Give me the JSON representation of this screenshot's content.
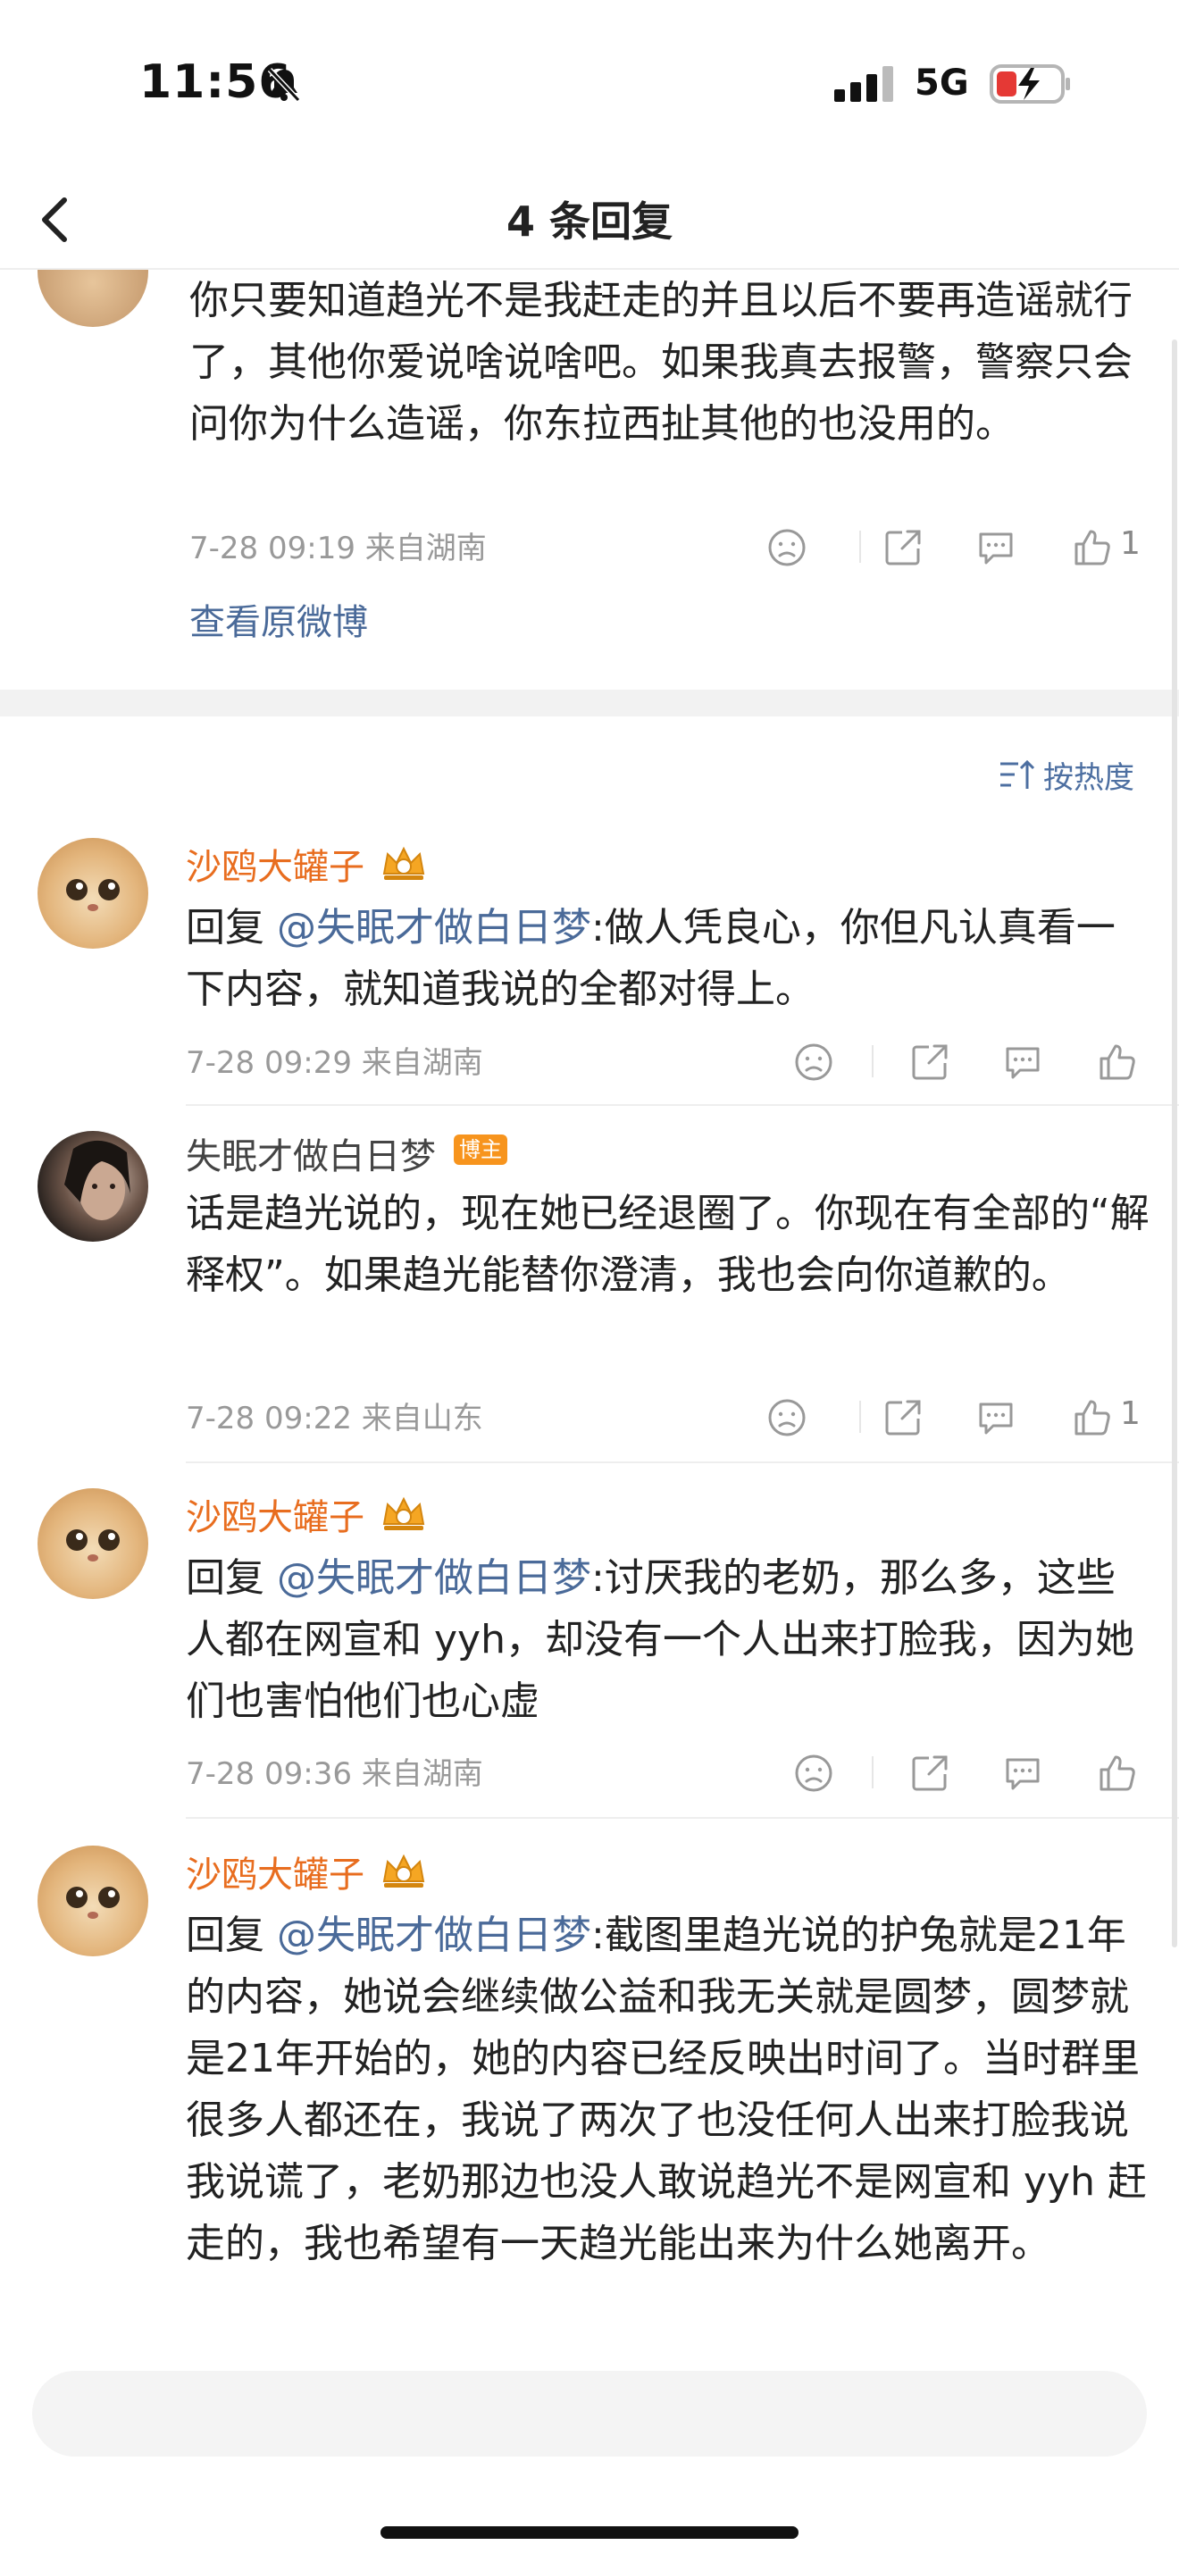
{
  "status_bar": {
    "time": "11:56",
    "network": "5G"
  },
  "nav": {
    "title": "4 条回复"
  },
  "original_post": {
    "text": "你只要知道趋光不是我赶走的并且以后不要再造谣就行了，其他你爱说啥说啥吧。如果我真去报警，警察只会问你为什么造谣，你东拉西扯其他的也没用的。",
    "meta": "7-28 09:19  来自湖南",
    "like_count": "1",
    "view_original_label": "查看原微博"
  },
  "sort": {
    "label": "按热度"
  },
  "replies": [
    {
      "username": "沙鸥大罐子",
      "reply_prefix": "回复 ",
      "mention": "@失眠才做白日梦",
      "body": ":做人凭良心，你但凡认真看一下内容，就知道我说的全都对得上。",
      "meta": "7-28 09:29  来自湖南",
      "like_count": ""
    },
    {
      "username": "失眠才做白日梦",
      "badge": "博主",
      "reply_prefix": "",
      "mention": "",
      "body": "话是趋光说的，现在她已经退圈了。你现在有全部的“解释权”。如果趋光能替你澄清，我也会向你道歉的。",
      "meta": "7-28 09:22  来自山东",
      "like_count": "1"
    },
    {
      "username": "沙鸥大罐子",
      "reply_prefix": "回复 ",
      "mention": "@失眠才做白日梦",
      "body": ":讨厌我的老奶，那么多，这些人都在网宣和 yyh，却没有一个人出来打脸我，因为她们也害怕他们也心虚",
      "meta": "7-28 09:36  来自湖南",
      "like_count": ""
    },
    {
      "username": "沙鸥大罐子",
      "reply_prefix": "回复 ",
      "mention": "@失眠才做白日梦",
      "body": ":截图里趋光说的护兔就是21年的内容，她说会继续做公益和我无关就是圆梦，圆梦就是21年开始的，她的内容已经反映出时间了。当时群里很多人都还在，我说了两次了也没任何人出来打脸我说我说谎了，老奶那边也没人敢说趋光不是网宣和 yyh 赶走的，我也希望有一天趋光能出来为什么她离开。",
      "meta": "",
      "like_count": ""
    }
  ],
  "comment_bar": {
    "placeholder": ""
  },
  "icons": [
    "bell-slash-icon",
    "signal-icon",
    "battery-charging-icon",
    "chevron-left-icon",
    "sort-icon",
    "dislike-icon",
    "repost-icon",
    "comment-icon",
    "like-icon"
  ],
  "colors": {
    "username_orange": "#e86d1f",
    "link_blue": "#4a6a99",
    "meta_gray": "#999999",
    "owner_badge": "#f7941d"
  }
}
